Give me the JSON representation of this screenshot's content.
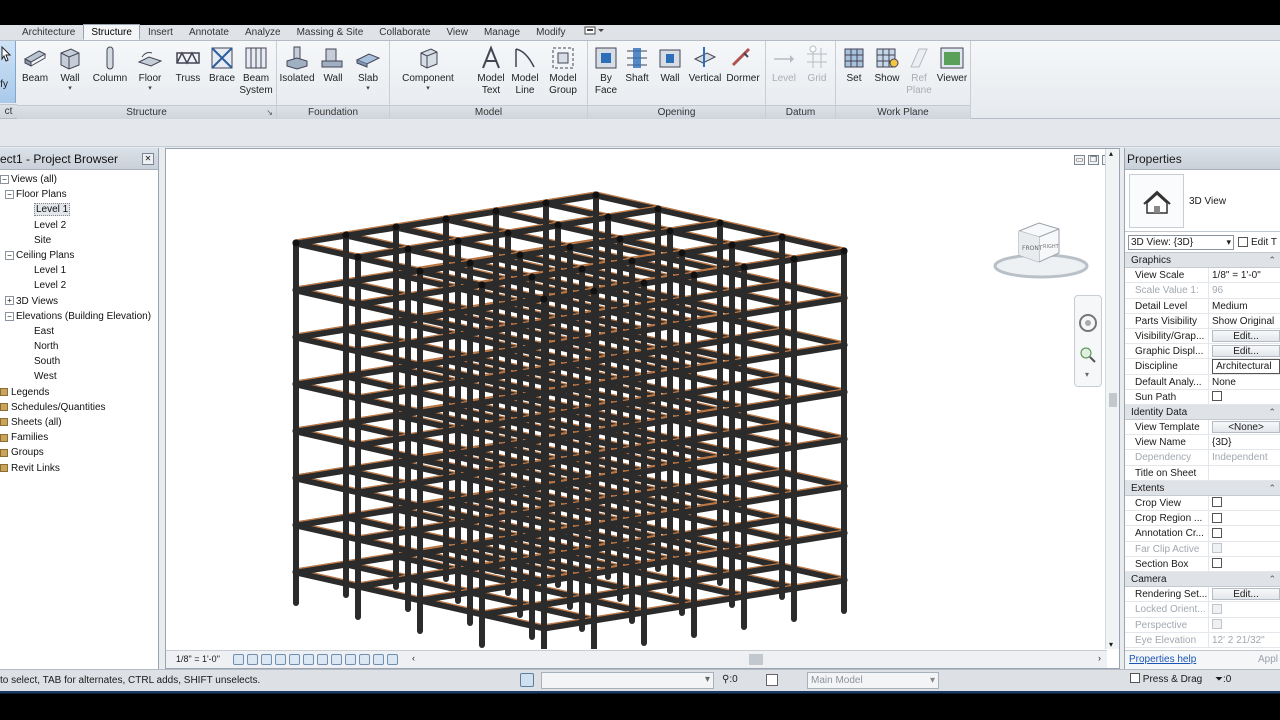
{
  "ribbon": {
    "tabs": [
      "Architecture",
      "Structure",
      "Insert",
      "Annotate",
      "Analyze",
      "Massing & Site",
      "Collaborate",
      "View",
      "Manage",
      "Modify"
    ],
    "active_tab": "Structure",
    "modify_label": "ify",
    "select_panel_label": "ct",
    "panels": {
      "structure": {
        "title": "Structure",
        "buttons": [
          "Beam",
          "Wall",
          "Column",
          "Floor",
          "Truss",
          "Brace",
          "Beam\nSystem"
        ]
      },
      "foundation": {
        "title": "Foundation",
        "buttons": [
          "Isolated",
          "Wall",
          "Slab"
        ]
      },
      "model": {
        "title": "Model",
        "buttons": [
          "Component",
          "Model\nText",
          "Model\nLine",
          "Model\nGroup"
        ]
      },
      "opening": {
        "title": "Opening",
        "buttons": [
          "By\nFace",
          "Shaft",
          "Wall",
          "Vertical",
          "Dormer"
        ]
      },
      "datum": {
        "title": "Datum",
        "buttons": [
          "Level",
          "Grid"
        ]
      },
      "work_plane": {
        "title": "Work Plane",
        "buttons": [
          "Set",
          "Show",
          "Ref\nPlane",
          "Viewer"
        ]
      }
    }
  },
  "project_browser": {
    "title": "ect1 - Project Browser",
    "tree": [
      {
        "label": "Views (all)",
        "depth": 0,
        "toggle": "−"
      },
      {
        "label": "Floor Plans",
        "depth": 1,
        "toggle": "−"
      },
      {
        "label": "Level 1",
        "depth": 2,
        "selected": true
      },
      {
        "label": "Level 2",
        "depth": 2
      },
      {
        "label": "Site",
        "depth": 2
      },
      {
        "label": "Ceiling Plans",
        "depth": 1,
        "toggle": "−"
      },
      {
        "label": "Level 1",
        "depth": 2
      },
      {
        "label": "Level 2",
        "depth": 2
      },
      {
        "label": "3D Views",
        "depth": 1,
        "toggle": "+"
      },
      {
        "label": "Elevations (Building Elevation)",
        "depth": 1,
        "toggle": "−"
      },
      {
        "label": "East",
        "depth": 2
      },
      {
        "label": "North",
        "depth": 2
      },
      {
        "label": "South",
        "depth": 2
      },
      {
        "label": "West",
        "depth": 2
      },
      {
        "label": "Legends",
        "depth": 0,
        "icon": true
      },
      {
        "label": "Schedules/Quantities",
        "depth": 0,
        "icon": true
      },
      {
        "label": "Sheets (all)",
        "depth": 0,
        "icon": true
      },
      {
        "label": "Families",
        "depth": 0,
        "icon": true
      },
      {
        "label": "Groups",
        "depth": 0,
        "icon": true
      },
      {
        "label": "Revit Links",
        "depth": 0,
        "icon": true
      }
    ]
  },
  "viewport": {
    "scale": "1/8\" = 1'-0\"",
    "viewcube": {
      "front": "FRONT",
      "right": "RIGHT"
    }
  },
  "properties": {
    "title": "Properties",
    "type_name": "3D View",
    "instance_selector": "3D View: {3D}",
    "edit_type": "Edit T",
    "groups": [
      {
        "name": "Graphics",
        "rows": [
          {
            "key": "View Scale",
            "value": "1/8\" = 1'-0\""
          },
          {
            "key": "Scale Value    1:",
            "value": "96",
            "dim": true
          },
          {
            "key": "Detail Level",
            "value": "Medium"
          },
          {
            "key": "Parts Visibility",
            "value": "Show Original"
          },
          {
            "key": "Visibility/Grap...",
            "value": "Edit...",
            "button": true
          },
          {
            "key": "Graphic Displ...",
            "value": "Edit...",
            "button": true
          },
          {
            "key": "Discipline",
            "value": "Architectural",
            "boxed": true
          },
          {
            "key": "Default Analy...",
            "value": "None"
          },
          {
            "key": "Sun Path",
            "value": "",
            "check": true
          }
        ]
      },
      {
        "name": "Identity Data",
        "rows": [
          {
            "key": "View Template",
            "value": "<None>",
            "button": true
          },
          {
            "key": "View Name",
            "value": "{3D}"
          },
          {
            "key": "Dependency",
            "value": "Independent",
            "dim": true
          },
          {
            "key": "Title on Sheet",
            "value": ""
          }
        ]
      },
      {
        "name": "Extents",
        "rows": [
          {
            "key": "Crop View",
            "value": "",
            "check": true
          },
          {
            "key": "Crop Region ...",
            "value": "",
            "check": true
          },
          {
            "key": "Annotation Cr...",
            "value": "",
            "check": true
          },
          {
            "key": "Far Clip Active",
            "value": "",
            "check": true,
            "dim": true
          },
          {
            "key": "Section Box",
            "value": "",
            "check": true
          }
        ]
      },
      {
        "name": "Camera",
        "rows": [
          {
            "key": "Rendering Set...",
            "value": "Edit...",
            "button": true
          },
          {
            "key": "Locked Orient...",
            "value": "",
            "check": true,
            "dim": true
          },
          {
            "key": "Perspective",
            "value": "",
            "check": true,
            "dim": true
          },
          {
            "key": "Eye Elevation",
            "value": "12'  2 21/32\"",
            "dim": true
          }
        ]
      }
    ],
    "help_link": "Properties help",
    "apply": "Appl"
  },
  "status_bar": {
    "message": "to select, TAB for alternates, CTRL adds, SHIFT unselects.",
    "filter_count": ":0",
    "model": "Main Model",
    "press_drag": "Press & Drag",
    "select_count": ":0"
  },
  "colors": {
    "beam_top": "#c27a45",
    "member": "#2b2b2b",
    "accent": "#1c3a66"
  }
}
